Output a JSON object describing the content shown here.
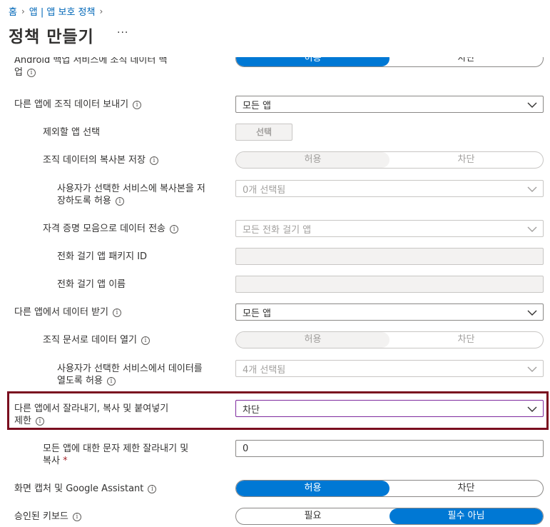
{
  "breadcrumb": {
    "home": "홈",
    "app": "앱 | 앱 보호 정책"
  },
  "page": {
    "title": "정책 만들기",
    "more": "···"
  },
  "rows": {
    "r0": {
      "label_line1": "Android 백업 서비스에 조직 데이터 백",
      "label_line2": "업",
      "opt1": "허용",
      "opt2": "차단"
    },
    "r1": {
      "label": "다른 앱에 조직 데이터 보내기",
      "value": "모든 앱"
    },
    "r2": {
      "label": "제외할 앱 선택",
      "button": "선택"
    },
    "r3": {
      "label": "조직 데이터의 복사본 저장",
      "opt1": "허용",
      "opt2": "차단"
    },
    "r4": {
      "label_line1": "사용자가 선택한 서비스에 복사본을 저",
      "label_line2": "장하도록 허용",
      "value": "0개 선택됨"
    },
    "r5": {
      "label": "자격 증명 모음으로 데이터 전송",
      "value": "모든 전화 걸기 앱"
    },
    "r6": {
      "label": "전화 걸기 앱 패키지 ID",
      "value": ""
    },
    "r7": {
      "label": "전화 걸기 앱 이름",
      "value": ""
    },
    "r8": {
      "label": "다른 앱에서 데이터 받기",
      "value": "모든 앱"
    },
    "r9": {
      "label": "조직 문서로 데이터 열기",
      "opt1": "허용",
      "opt2": "차단"
    },
    "r10": {
      "label_line1": "사용자가 선택한 서비스에서 데이터를",
      "label_line2": "열도록 허용",
      "value": "4개 선택됨"
    },
    "r11": {
      "label_line1": "다른 앱에서 잘라내기, 복사 및 붙여넣기",
      "label_line2": "제한",
      "value": "차단"
    },
    "r12": {
      "label_line1": "모든 앱에 대한 문자 제한 잘라내기 및",
      "label_line2": "복사",
      "required": "*",
      "value": "0"
    },
    "r13": {
      "label": "화면 캡처 및 Google Assistant",
      "opt1": "허용",
      "opt2": "차단"
    },
    "r14": {
      "label": "승인된 키보드",
      "opt1": "필요",
      "opt2": "필수 아님"
    }
  },
  "colors": {
    "accent": "#0078d4",
    "highlight_border": "#7a0e1f",
    "focus_border": "#7e2a9e",
    "link": "#0067b8"
  }
}
